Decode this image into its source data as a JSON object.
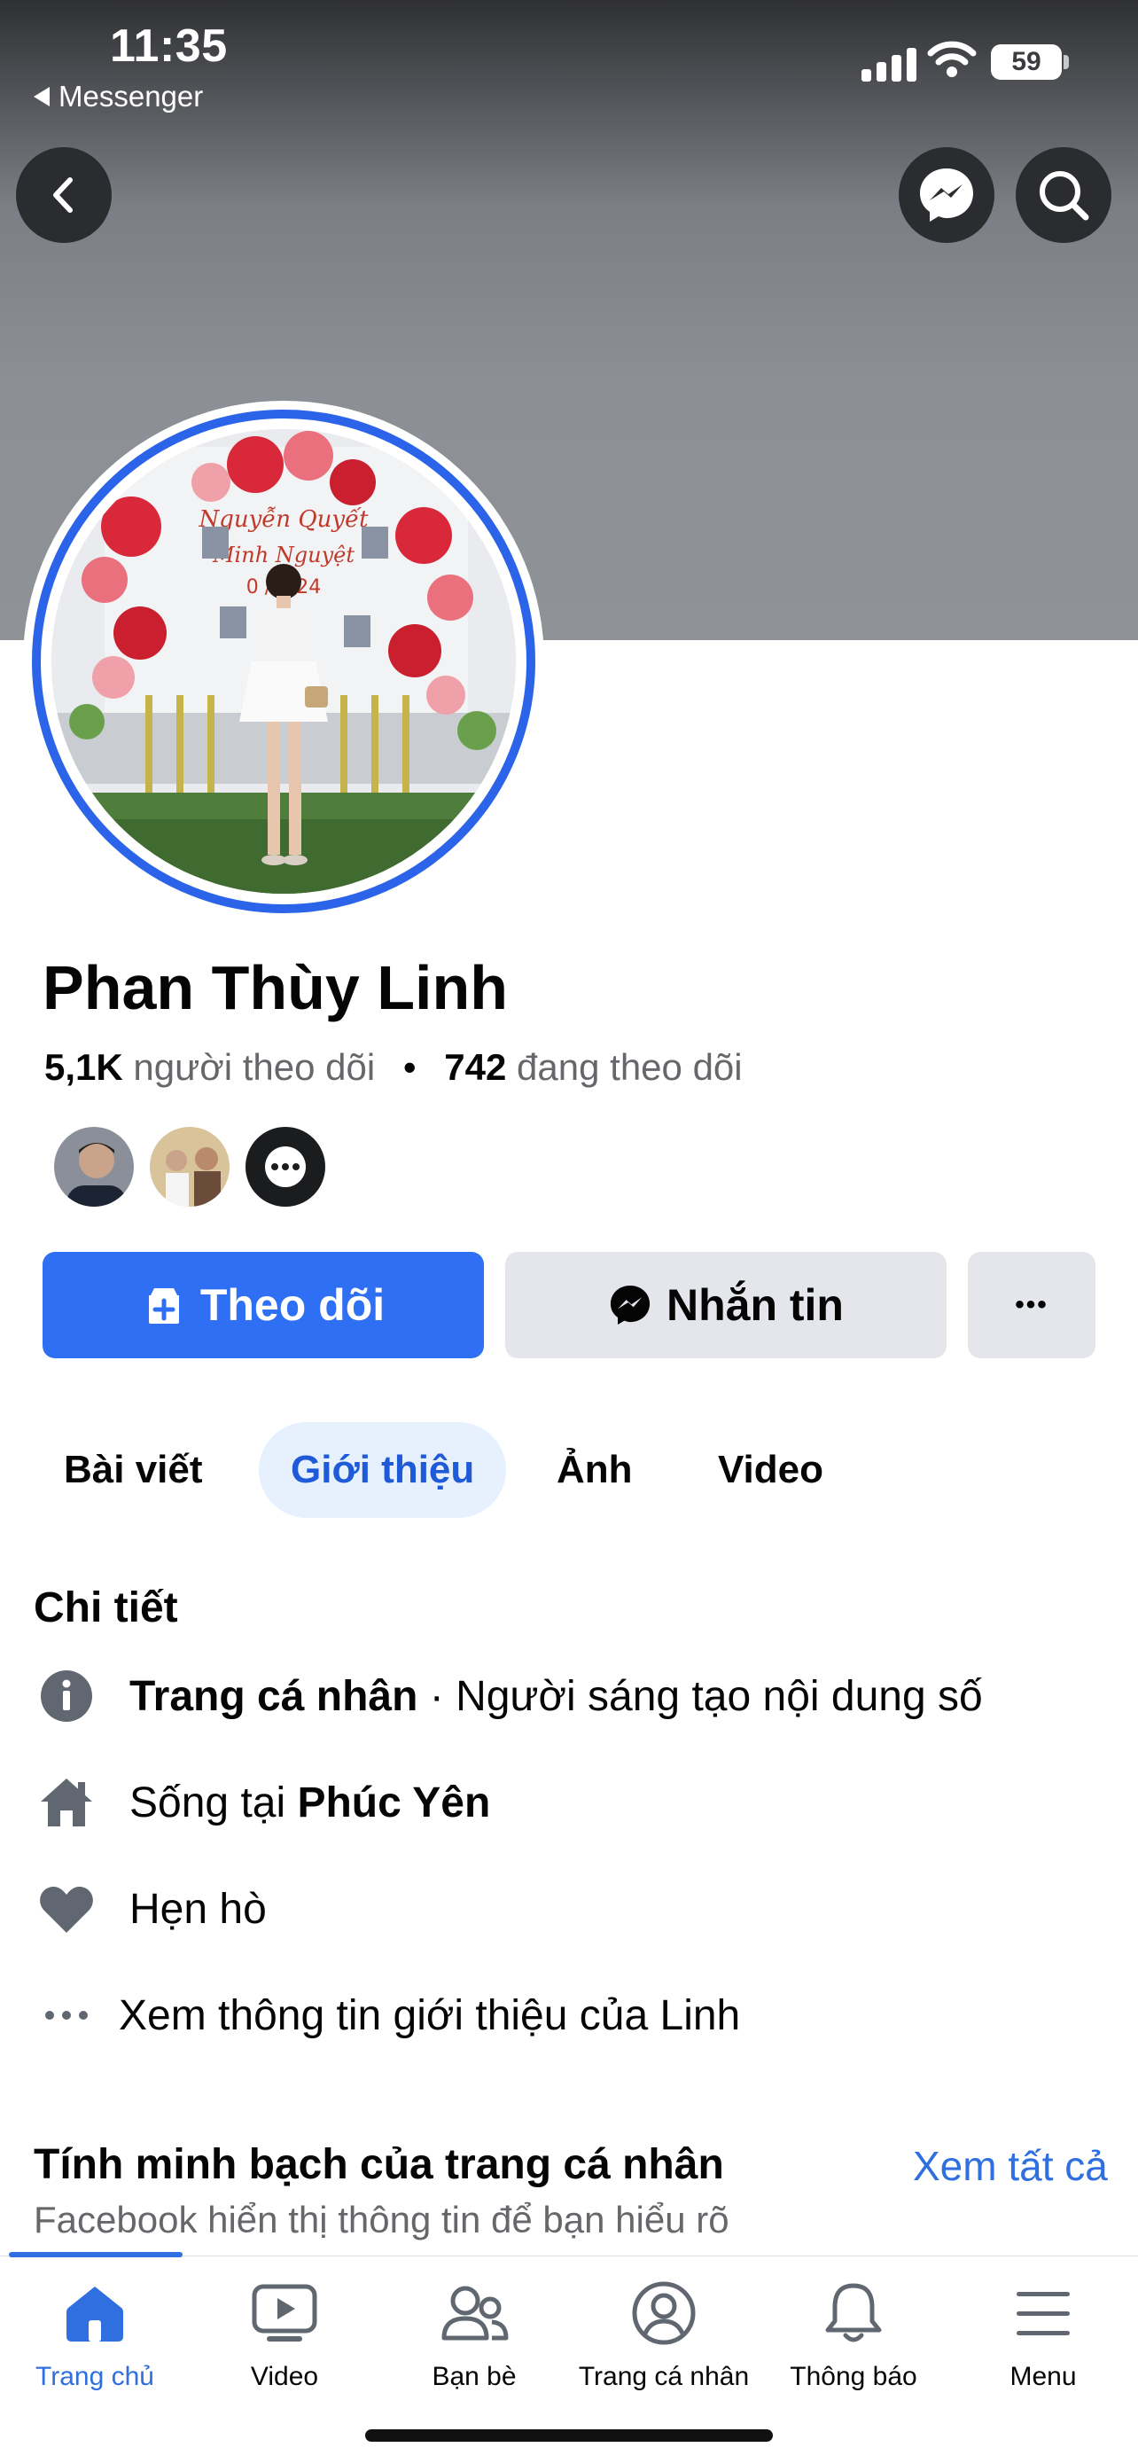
{
  "status_bar": {
    "time": "11:35",
    "back_app": "Messenger",
    "battery": "59"
  },
  "profile": {
    "name": "Phan Thùy Linh",
    "followers_count": "5,1K",
    "followers_label": "người theo dõi",
    "separator": "•",
    "following_count": "742",
    "following_label": "đang theo dõi",
    "cover_text_line1": "Nguyễn Quyết",
    "cover_text_line2": "Minh Nguyệt",
    "cover_text_date": "0 /2024"
  },
  "actions": {
    "follow": "Theo dõi",
    "message": "Nhắn tin",
    "more": "•••"
  },
  "tabs": [
    {
      "label": "Bài viết",
      "active": false
    },
    {
      "label": "Giới thiệu",
      "active": true
    },
    {
      "label": "Ảnh",
      "active": false
    },
    {
      "label": "Video",
      "active": false
    }
  ],
  "details": {
    "title": "Chi tiết",
    "items": [
      {
        "icon": "info-icon",
        "bold": "Trang cá nhân",
        "text": " · Người sáng tạo nội dung số"
      },
      {
        "icon": "home-icon",
        "text": "Sống tại ",
        "bold": "Phúc Yên"
      },
      {
        "icon": "heart-icon",
        "text": "Hẹn hò"
      },
      {
        "icon": "ellipsis-icon",
        "text": "Xem thông tin giới thiệu của Linh"
      }
    ]
  },
  "transparency": {
    "title": "Tính minh bạch của trang cá nhân",
    "see_all": "Xem tất cả",
    "subtitle": "Facebook hiển thị thông tin để bạn hiểu rõ"
  },
  "bottom_nav": [
    {
      "label": "Trang chủ",
      "icon": "home-icon",
      "active": true
    },
    {
      "label": "Video",
      "icon": "video-icon",
      "active": false
    },
    {
      "label": "Bạn bè",
      "icon": "friends-icon",
      "active": false
    },
    {
      "label": "Trang cá nhân",
      "icon": "profile-icon",
      "active": false
    },
    {
      "label": "Thông báo",
      "icon": "bell-icon",
      "active": false
    },
    {
      "label": "Menu",
      "icon": "menu-icon",
      "active": false
    }
  ],
  "colors": {
    "primary": "#2e6ff3",
    "link": "#2f6fdf",
    "avatar_ring": "#2b63e9",
    "tab_active_bg": "#e7f0fd",
    "secondary_text": "#65676b"
  }
}
